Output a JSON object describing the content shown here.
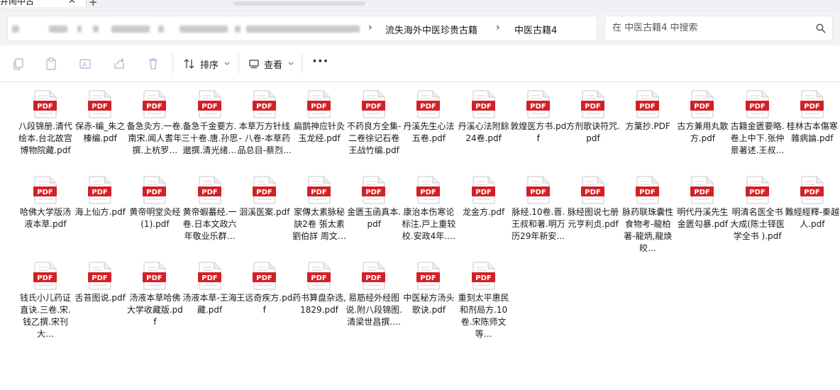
{
  "window": {
    "tab_title": "井闹中古",
    "tab_close": "✕",
    "new_tab": "+"
  },
  "address": {
    "separator": "›",
    "crumbs": [
      "流失海外中医珍贵古籍",
      "中医古籍4"
    ]
  },
  "search": {
    "placeholder": "在 中医古籍4 中搜索"
  },
  "toolbar": {
    "sort_label": "排序",
    "view_label": "查看",
    "more_label": "···"
  },
  "icons": {
    "pdf_badge_text": "PDF",
    "pdf_color": "#d32026",
    "file_names": [
      "file-pdf-icon"
    ]
  },
  "files": [
    "八段锦册.清代绘本.台北故宫博物院藏.pdf",
    "保赤-编_朱之榛编.pdf",
    "备急灸方.一卷.南宋.闻人耆年撰.上杭罗…",
    "备急千金要方.三十卷.唐.孙思邈撰.清光绪…",
    "本草万方针线 - 八卷-本草药品总目-蔡烈…",
    "扁鹊神应针灸玉龙经.pdf",
    "不药良方全集-二卷徐记石卷王战竹编.pdf",
    "丹溪先生心法五卷.pdf",
    "丹溪心法附餘 24卷.pdf",
    "敦煌医方书.pdf",
    "方剂歌诀符咒.pdf",
    "方葉抄.PDF",
    "古方兼用丸散方.pdf",
    "古籍金匮要略.卷上中下.张仲景著述.王叔…",
    "桂林古本傷寒雜病論.pdf",
    "哈佛大学版汤液本草.pdf",
    "海上仙方.pdf",
    "黄帝明堂灸经(1).pdf",
    "黄帝蝦蟇经.一卷.日本文政六年敬业乐群…",
    "洄溪医案.pdf",
    "家傳太素脉秘訣2卷 張太素 劉伯詳 周文…",
    "金匮玉函真本.pdf",
    "康治本伤寒论标注.戸上重较校.安政4年.…",
    "龙金方.pdf",
    "脉经.10卷.晋.王叔和著.明万历29年新安…",
    "脉经图说七册元亨利贞.pdf",
    "脉药联珠囊性食物考-龍柏著-龍炳,龍焕皎…",
    "明代丹溪先生金匮勾暴.pdf",
    "明清名医全书大成(陈士铎医学全书 ).pdf",
    "難經經釋-秦越人.pdf",
    "钱氏小儿药证直诀.三卷.宋.钱乙撰.宋刊大…",
    "舌苔图说.pdf",
    "汤液本草哈佛大学收藏版.pdf",
    "汤液本草-王海藏.pdf",
    "王远奇疾方.pdf",
    "药书算盘杂选,1829.pdf",
    "易筋经外经图说.附八段锦图.清梁世昌撰.…",
    "中医秘方汤头歌诀.pdf",
    "重刻太平惠民和剂局方.10卷.宋陈师文等…"
  ]
}
